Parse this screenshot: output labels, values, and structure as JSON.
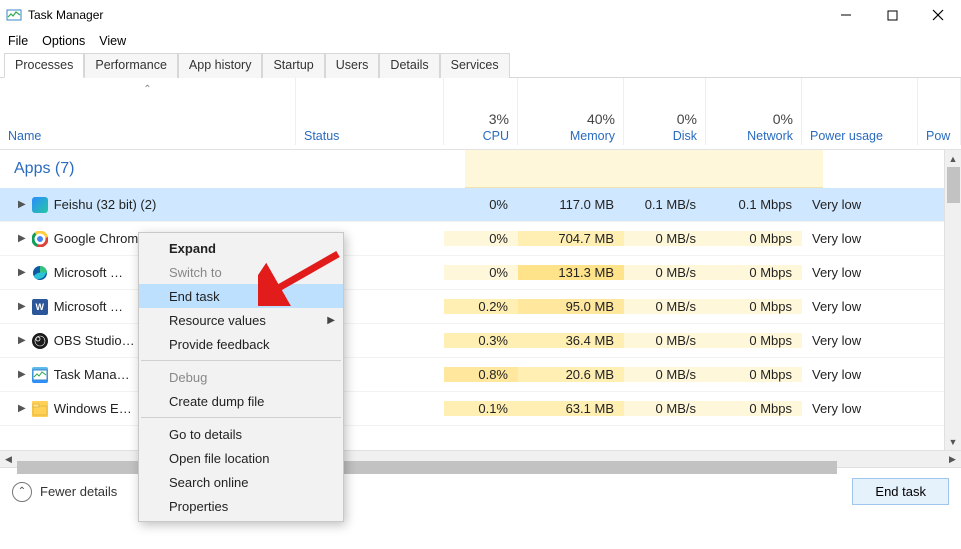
{
  "titlebar": {
    "title": "Task Manager"
  },
  "menubar": {
    "items": [
      "File",
      "Options",
      "View"
    ]
  },
  "tabs": {
    "items": [
      "Processes",
      "Performance",
      "App history",
      "Startup",
      "Users",
      "Details",
      "Services"
    ],
    "active_index": 0
  },
  "columns": {
    "name": "Name",
    "status": "Status",
    "cpu": "CPU",
    "memory": "Memory",
    "disk": "Disk",
    "network": "Network",
    "power": "Power usage",
    "trail": "Pow",
    "metrics": {
      "cpu": "3%",
      "memory": "40%",
      "disk": "0%",
      "network": "0%"
    }
  },
  "section": {
    "apps": "Apps (7)"
  },
  "processes": [
    {
      "name": "Feishu (32 bit) (2)",
      "cpu": "0%",
      "mem": "117.0 MB",
      "disk": "0.1 MB/s",
      "net": "0.1 Mbps",
      "power": "Very low",
      "icon": "feishu"
    },
    {
      "name": "Google Chrom…",
      "cpu": "0%",
      "mem": "704.7 MB",
      "disk": "0 MB/s",
      "net": "0 Mbps",
      "power": "Very low",
      "icon": "chrome"
    },
    {
      "name": "Microsoft …",
      "cpu": "0%",
      "mem": "131.3 MB",
      "disk": "0 MB/s",
      "net": "0 Mbps",
      "power": "Very low",
      "icon": "edge"
    },
    {
      "name": "Microsoft …",
      "cpu": "0.2%",
      "mem": "95.0 MB",
      "disk": "0 MB/s",
      "net": "0 Mbps",
      "power": "Very low",
      "icon": "word"
    },
    {
      "name": "OBS Studio…",
      "cpu": "0.3%",
      "mem": "36.4 MB",
      "disk": "0 MB/s",
      "net": "0 Mbps",
      "power": "Very low",
      "icon": "obs"
    },
    {
      "name": "Task Mana…",
      "cpu": "0.8%",
      "mem": "20.6 MB",
      "disk": "0 MB/s",
      "net": "0 Mbps",
      "power": "Very low",
      "icon": "taskmgr"
    },
    {
      "name": "Windows E…",
      "cpu": "0.1%",
      "mem": "63.1 MB",
      "disk": "0 MB/s",
      "net": "0 Mbps",
      "power": "Very low",
      "icon": "explorer"
    }
  ],
  "context_menu": {
    "items": [
      {
        "label": "Expand",
        "bold": true
      },
      {
        "label": "Switch to",
        "disabled": true
      },
      {
        "label": "End task",
        "highlight": true
      },
      {
        "label": "Resource values",
        "submenu": true
      },
      {
        "label": "Provide feedback"
      },
      {
        "sep": true
      },
      {
        "label": "Debug",
        "disabled": true
      },
      {
        "label": "Create dump file"
      },
      {
        "sep": true
      },
      {
        "label": "Go to details"
      },
      {
        "label": "Open file location"
      },
      {
        "label": "Search online"
      },
      {
        "label": "Properties"
      }
    ]
  },
  "footer": {
    "fewer": "Fewer details",
    "end_task": "End task"
  }
}
